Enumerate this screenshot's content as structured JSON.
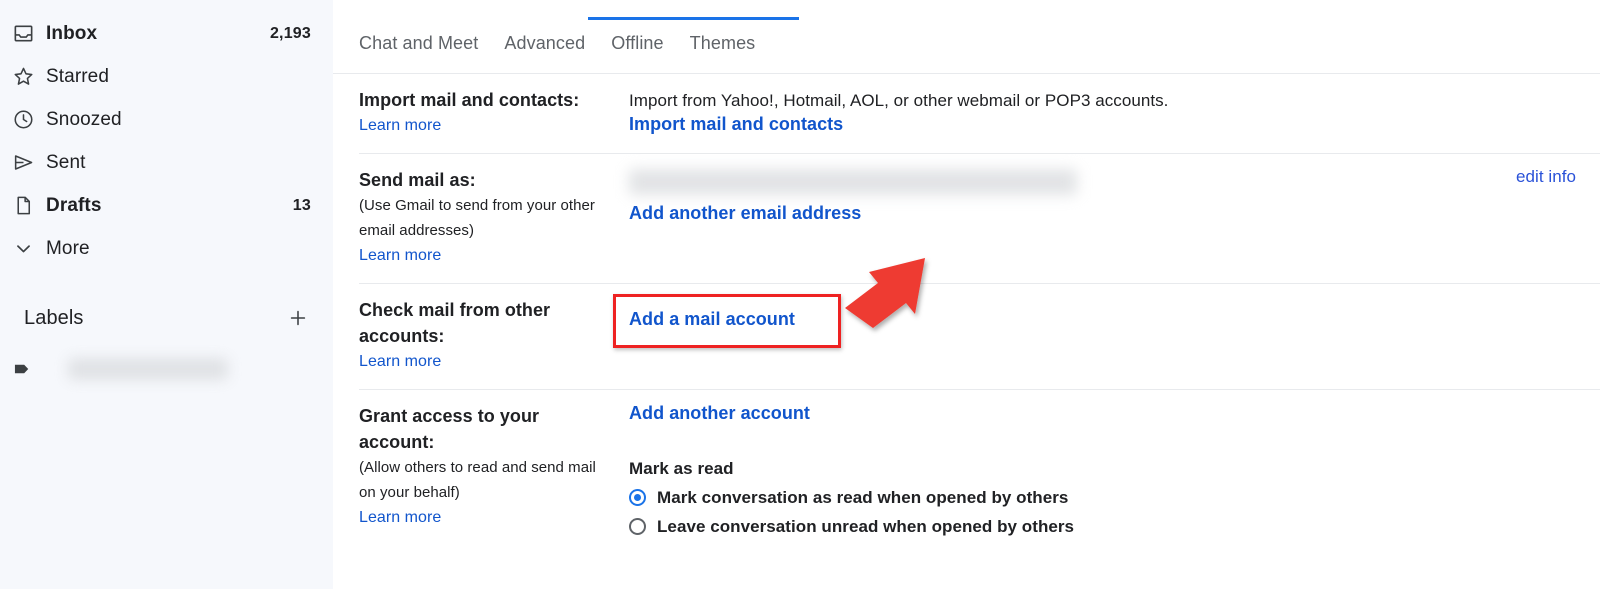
{
  "sidebar": {
    "items": [
      {
        "label": "Inbox",
        "icon": "inbox-icon",
        "count": "2,193",
        "bold": true
      },
      {
        "label": "Starred",
        "icon": "star-icon",
        "count": "",
        "bold": false
      },
      {
        "label": "Snoozed",
        "icon": "clock-icon",
        "count": "",
        "bold": false
      },
      {
        "label": "Sent",
        "icon": "send-icon",
        "count": "",
        "bold": false
      },
      {
        "label": "Drafts",
        "icon": "draft-icon",
        "count": "13",
        "bold": true
      },
      {
        "label": "More",
        "icon": "chevron-down-icon",
        "count": "",
        "bold": false
      }
    ],
    "labels_section": {
      "title": "Labels",
      "add_label_icon": "plus-icon",
      "items": [
        {
          "icon": "label-tag-icon",
          "name": "",
          "redacted": true
        }
      ]
    }
  },
  "tabs": {
    "partial_active_label": "",
    "partial_right_label": "",
    "items": [
      {
        "label": "Chat and Meet",
        "active": false
      },
      {
        "label": "Advanced",
        "active": false
      },
      {
        "label": "Offline",
        "active": false
      },
      {
        "label": "Themes",
        "active": false
      }
    ]
  },
  "settings": {
    "import": {
      "label": "Import mail and contacts:",
      "learn_more": "Learn more",
      "description": "Import from Yahoo!, Hotmail, AOL, or other webmail or POP3 accounts.",
      "action_link": "Import mail and contacts"
    },
    "send_mail_as": {
      "label": "Send mail as:",
      "note": "(Use Gmail to send from your other email addresses)",
      "learn_more": "Learn more",
      "address_redacted": "",
      "add_link": "Add another email address",
      "edit_link": "edit info"
    },
    "check_mail": {
      "label": "Check mail from other accounts:",
      "learn_more": "Learn more",
      "action_link": "Add a mail account"
    },
    "grant_access": {
      "label": "Grant access to your account:",
      "note": "(Allow others to read and send mail on your behalf)",
      "learn_more": "Learn more",
      "add_link": "Add another account",
      "mark_as_read_title": "Mark as read",
      "options": [
        {
          "label": "Mark conversation as read when opened by others",
          "selected": true
        },
        {
          "label": "Leave conversation unread when opened by others",
          "selected": false
        }
      ]
    }
  },
  "annotation": {
    "highlight_target": "Add a mail account",
    "arrow_color": "#ee3b30",
    "box_color": "#ee2222"
  },
  "colors": {
    "sidebar_bg": "#f6f8fc",
    "link_blue": "#1155cc",
    "accent_blue": "#1a73e8",
    "text_primary": "#202124",
    "text_secondary": "#5f6368",
    "divider": "#e8eaed"
  }
}
